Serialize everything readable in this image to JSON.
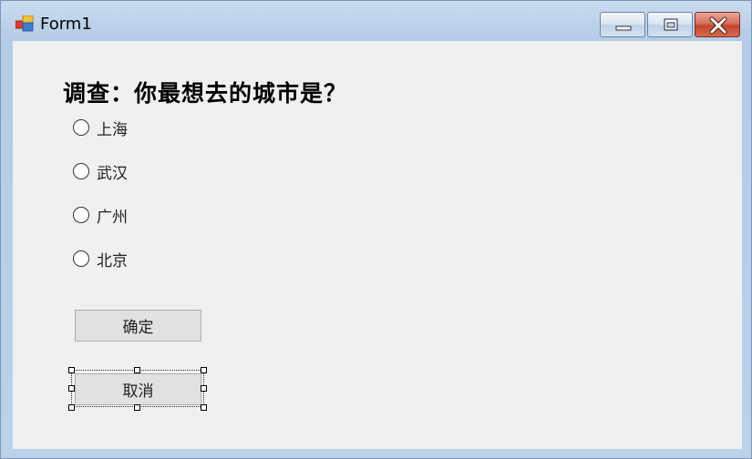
{
  "window": {
    "title": "Form1",
    "icon": "winforms-app-icon",
    "caption_buttons": [
      "minimize-icon",
      "maximize-icon",
      "close-icon"
    ]
  },
  "form": {
    "question": "调查：你最想去的城市是？",
    "options": [
      {
        "label": "上海",
        "checked": false
      },
      {
        "label": "武汉",
        "checked": false
      },
      {
        "label": "广州",
        "checked": false
      },
      {
        "label": "北京",
        "checked": false
      }
    ],
    "ok_label": "确定",
    "cancel_label": "取消",
    "selected_control": "cancel-button"
  },
  "colors": {
    "client_bg": "#f0f0f0",
    "button_bg": "#e1e1e1",
    "close_red": "#c2462c",
    "title_bar": "#b4cbe6"
  }
}
